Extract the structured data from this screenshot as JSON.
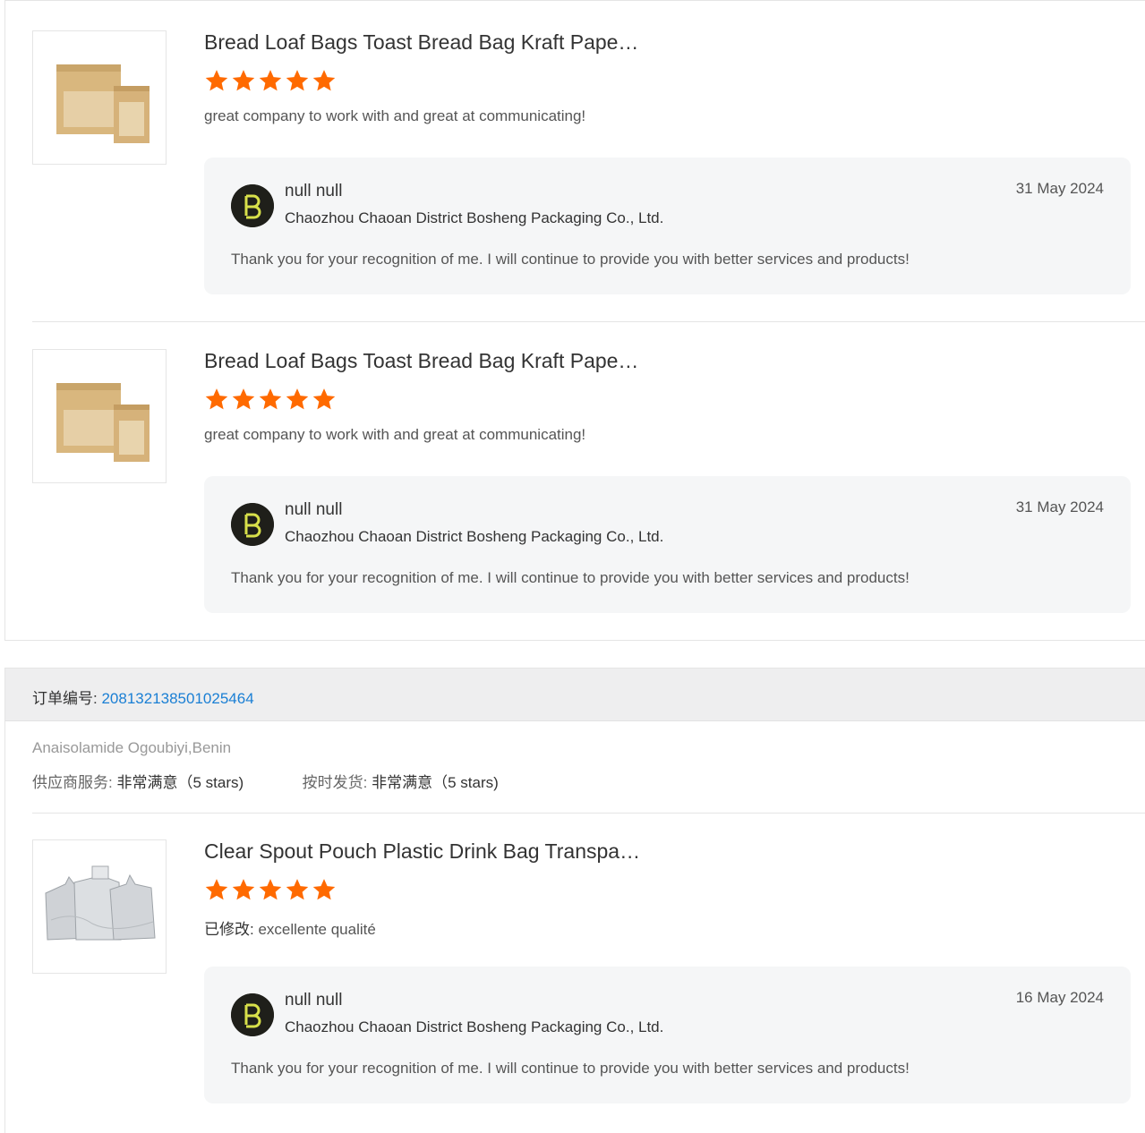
{
  "reviews_block1": [
    {
      "title": "Bread Loaf Bags Toast Bread Bag Kraft Pape…",
      "rating": 5,
      "comment": "great company to work with and great at communicating!",
      "reply": {
        "name": "null null",
        "company": "Chaozhou Chaoan District Bosheng Packaging Co., Ltd.",
        "date": "31 May 2024",
        "text": "Thank you for your recognition of me. I will continue to provide you with better services and products!"
      }
    },
    {
      "title": "Bread Loaf Bags Toast Bread Bag Kraft Pape…",
      "rating": 5,
      "comment": "great company to work with and great at communicating!",
      "reply": {
        "name": "null null",
        "company": "Chaozhou Chaoan District Bosheng Packaging Co., Ltd.",
        "date": "31 May 2024",
        "text": "Thank you for your recognition of me. I will continue to provide you with better services and products!"
      }
    }
  ],
  "order": {
    "label": "订单编号:",
    "number": "208132138501025464",
    "buyer": "Anaisolamide Ogoubiyi,Benin",
    "supplier_service_label": "供应商服务:",
    "supplier_service_value": "非常满意（5 stars)",
    "on_time_label": "按时发货:",
    "on_time_value": "非常满意（5 stars)"
  },
  "reviews_block2": [
    {
      "title": "Clear Spout Pouch Plastic Drink Bag Transpa…",
      "rating": 5,
      "comment_prefix": "已修改:",
      "comment": " excellente qualité",
      "reply": {
        "name": "null null",
        "company": "Chaozhou Chaoan District Bosheng Packaging Co., Ltd.",
        "date": "16 May 2024",
        "text": "Thank you for your recognition of me. I will continue to provide you with better services and products!"
      }
    }
  ],
  "colors": {
    "star": "#ff6a00",
    "link": "#1a7fd4",
    "reply_bg": "#f5f6f7",
    "order_header_bg": "#eeeeef"
  },
  "icons": {
    "star": "star-icon",
    "avatar": "company-logo-avatar"
  }
}
